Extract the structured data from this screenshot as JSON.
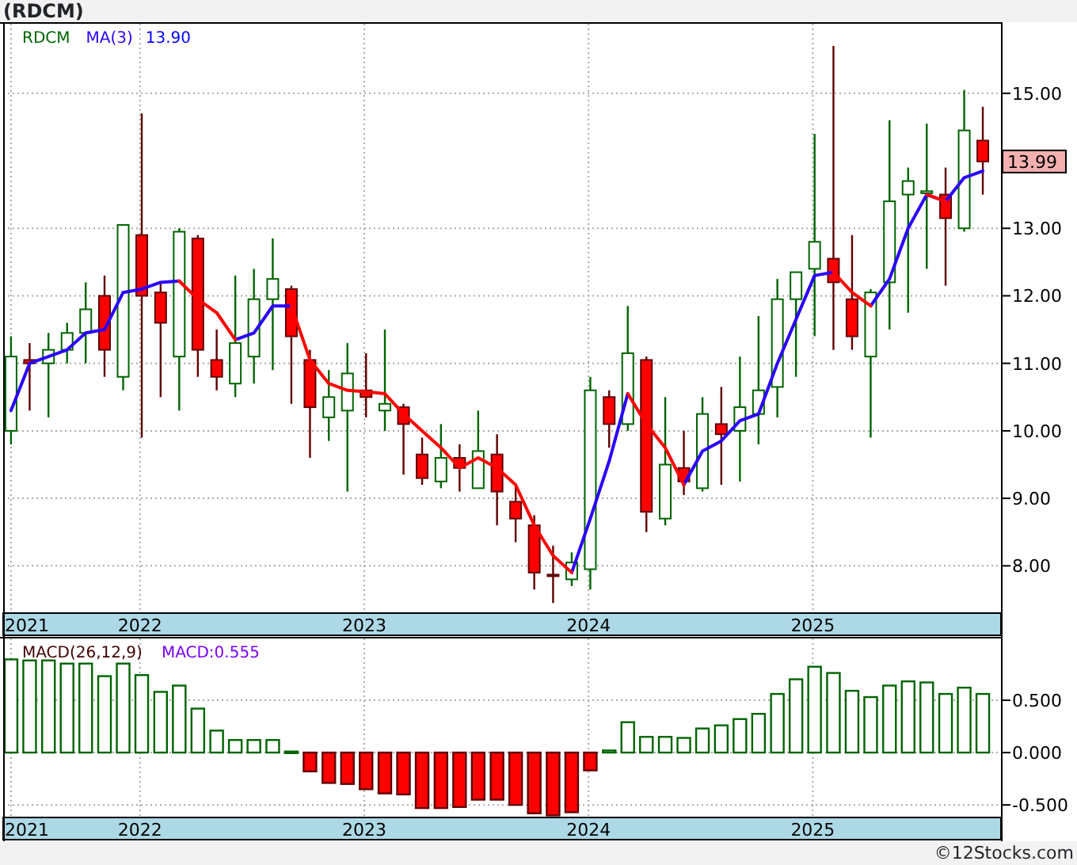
{
  "title": "(RDCM)",
  "price_panel": {
    "symbol": {
      "text": "RDCM",
      "color": "#006400"
    },
    "ma_value": {
      "text": "13.90",
      "color": "#0000ff"
    },
    "last_price": "13.99",
    "axis_start_label": "2021",
    "chart_data": {
      "type": "candlestick",
      "grid": true,
      "x": [
        2021.425,
        2021.508,
        2021.592,
        2021.675,
        2021.758,
        2021.842,
        2021.925,
        2022.008,
        2022.092,
        2022.175,
        2022.258,
        2022.342,
        2022.425,
        2022.508,
        2022.592,
        2022.675,
        2022.758,
        2022.842,
        2022.925,
        2023.008,
        2023.092,
        2023.175,
        2023.258,
        2023.342,
        2023.425,
        2023.508,
        2023.592,
        2023.675,
        2023.758,
        2023.842,
        2023.925,
        2024.008,
        2024.092,
        2024.175,
        2024.258,
        2024.342,
        2024.425,
        2024.508,
        2024.592,
        2024.675,
        2024.758,
        2024.842,
        2024.925,
        2025.008,
        2025.092,
        2025.175,
        2025.258,
        2025.342,
        2025.425,
        2025.508,
        2025.592,
        2025.675,
        2025.758
      ],
      "xlim": [
        2021.39,
        2025.839
      ],
      "ylim": [
        7.3,
        16.03
      ],
      "xticks": [
        {
          "value": 2022,
          "label": "2022"
        },
        {
          "value": 2023,
          "label": "2023"
        },
        {
          "value": 2024,
          "label": "2024"
        },
        {
          "value": 2025,
          "label": "2025"
        }
      ],
      "yticks": [
        {
          "value": 8,
          "label": "8.00"
        },
        {
          "value": 9,
          "label": "9.00"
        },
        {
          "value": 10,
          "label": "10.00"
        },
        {
          "value": 11,
          "label": "11.00"
        },
        {
          "value": 12,
          "label": "12.00"
        },
        {
          "value": 13,
          "label": "13.00"
        },
        {
          "value": 15,
          "label": "15.00"
        }
      ],
      "ohlc": [
        [
          10.0,
          11.4,
          9.8,
          11.1
        ],
        [
          11.05,
          11.3,
          10.3,
          11.0
        ],
        [
          11.0,
          11.45,
          10.2,
          11.2
        ],
        [
          11.2,
          11.6,
          11.0,
          11.45
        ],
        [
          11.45,
          12.2,
          11.0,
          11.8
        ],
        [
          12.0,
          12.3,
          10.8,
          11.2
        ],
        [
          10.8,
          13.05,
          10.6,
          13.05
        ],
        [
          12.9,
          14.7,
          9.9,
          12.0
        ],
        [
          12.05,
          12.2,
          10.5,
          11.6
        ],
        [
          11.1,
          13.0,
          10.3,
          12.95
        ],
        [
          12.85,
          12.9,
          10.8,
          11.2
        ],
        [
          11.05,
          11.5,
          10.6,
          10.8
        ],
        [
          10.7,
          12.3,
          10.5,
          11.3
        ],
        [
          11.1,
          12.4,
          10.7,
          11.95
        ],
        [
          11.95,
          12.85,
          10.9,
          12.25
        ],
        [
          12.1,
          12.15,
          10.4,
          11.4
        ],
        [
          11.05,
          11.2,
          9.6,
          10.35
        ],
        [
          10.2,
          10.9,
          9.85,
          10.5
        ],
        [
          10.3,
          11.3,
          9.1,
          10.85
        ],
        [
          10.6,
          11.15,
          10.2,
          10.5
        ],
        [
          10.3,
          11.5,
          10.0,
          10.4
        ],
        [
          10.35,
          10.4,
          9.35,
          10.1
        ],
        [
          9.65,
          9.9,
          9.2,
          9.3
        ],
        [
          9.25,
          10.1,
          9.15,
          9.6
        ],
        [
          9.6,
          9.8,
          9.1,
          9.45
        ],
        [
          9.15,
          10.3,
          9.15,
          9.7
        ],
        [
          9.65,
          9.95,
          8.6,
          9.1
        ],
        [
          8.95,
          9.2,
          8.35,
          8.7
        ],
        [
          8.6,
          8.75,
          7.65,
          7.9
        ],
        [
          7.87,
          8.3,
          7.45,
          7.85
        ],
        [
          7.8,
          8.2,
          7.7,
          8.05
        ],
        [
          7.95,
          10.8,
          7.65,
          10.6
        ],
        [
          10.5,
          10.6,
          9.75,
          10.1
        ],
        [
          10.1,
          11.85,
          10.0,
          11.15
        ],
        [
          11.05,
          11.1,
          8.5,
          8.8
        ],
        [
          8.7,
          10.5,
          8.6,
          9.5
        ],
        [
          9.45,
          10.0,
          9.05,
          9.25
        ],
        [
          9.15,
          10.5,
          9.1,
          10.25
        ],
        [
          10.1,
          10.65,
          9.2,
          9.95
        ],
        [
          10.0,
          11.1,
          9.25,
          10.35
        ],
        [
          10.25,
          11.7,
          9.8,
          10.6
        ],
        [
          10.65,
          12.25,
          10.2,
          11.95
        ],
        [
          11.95,
          12.35,
          10.8,
          12.35
        ],
        [
          12.4,
          14.4,
          11.4,
          12.8
        ],
        [
          12.55,
          15.7,
          11.2,
          12.2
        ],
        [
          11.95,
          12.9,
          11.2,
          11.4
        ],
        [
          11.1,
          12.1,
          9.9,
          12.05
        ],
        [
          12.2,
          14.6,
          11.5,
          13.4
        ],
        [
          13.5,
          13.9,
          11.75,
          13.7
        ],
        [
          13.52,
          14.55,
          12.4,
          13.55
        ],
        [
          13.5,
          13.9,
          12.15,
          13.15
        ],
        [
          13.0,
          15.05,
          12.95,
          14.45
        ],
        [
          14.3,
          14.8,
          13.5,
          13.99
        ]
      ],
      "series": [
        {
          "name": "MA(3)",
          "type": "line",
          "color": "#2a00ff",
          "values": [
            10.3,
            11.0,
            11.1,
            11.2,
            11.45,
            11.5,
            12.05,
            12.1,
            12.2,
            12.22,
            null,
            null,
            11.35,
            11.45,
            11.85,
            11.85,
            null,
            null,
            null,
            null,
            null,
            null,
            null,
            null,
            null,
            null,
            null,
            null,
            null,
            null,
            7.9,
            8.7,
            9.55,
            10.55,
            null,
            null,
            9.2,
            9.7,
            9.85,
            10.15,
            10.25,
            11.0,
            11.65,
            12.3,
            12.35,
            null,
            11.85,
            12.25,
            13.0,
            13.5,
            13.4,
            13.75,
            13.85
          ]
        },
        {
          "type": "line",
          "color": "#ff0000",
          "values": [
            null,
            null,
            null,
            null,
            null,
            null,
            null,
            null,
            null,
            12.22,
            11.95,
            11.75,
            11.35,
            null,
            null,
            11.85,
            11.05,
            10.7,
            10.6,
            10.58,
            10.55,
            10.25,
            10.0,
            9.75,
            9.45,
            9.6,
            9.45,
            9.2,
            8.6,
            8.15,
            7.9,
            null,
            null,
            10.55,
            10.1,
            9.75,
            9.2,
            null,
            null,
            null,
            null,
            null,
            null,
            null,
            12.35,
            12.05,
            11.85,
            null,
            null,
            13.5,
            13.4,
            null,
            null
          ]
        }
      ]
    }
  },
  "macd_panel": {
    "value_label": {
      "text": "MACD:0.555",
      "color": "#7a00ff"
    },
    "axis_start_label": "2021",
    "chart_data": {
      "type": "bar",
      "grid": true,
      "x": [
        2021.425,
        2021.508,
        2021.592,
        2021.675,
        2021.758,
        2021.842,
        2021.925,
        2022.008,
        2022.092,
        2022.175,
        2022.258,
        2022.342,
        2022.425,
        2022.508,
        2022.592,
        2022.675,
        2022.758,
        2022.842,
        2022.925,
        2023.008,
        2023.092,
        2023.175,
        2023.258,
        2023.342,
        2023.425,
        2023.508,
        2023.592,
        2023.675,
        2023.758,
        2023.842,
        2023.925,
        2024.008,
        2024.092,
        2024.175,
        2024.258,
        2024.342,
        2024.425,
        2024.508,
        2024.592,
        2024.675,
        2024.758,
        2024.842,
        2024.925,
        2025.008,
        2025.092,
        2025.175,
        2025.258,
        2025.342,
        2025.425,
        2025.508,
        2025.592,
        2025.675,
        2025.758
      ],
      "xlim": [
        2021.39,
        2025.839
      ],
      "ylim": [
        -0.62,
        1.09
      ],
      "xticks": [
        {
          "value": 2022,
          "label": "2022"
        },
        {
          "value": 2023,
          "label": "2023"
        },
        {
          "value": 2024,
          "label": "2024"
        },
        {
          "value": 2025,
          "label": "2025"
        }
      ],
      "yticks": [
        {
          "value": -0.5,
          "label": "-0.500"
        },
        {
          "value": 0,
          "label": "0.000"
        },
        {
          "value": 0.5,
          "label": "0.500"
        }
      ],
      "series": [
        {
          "name": "MACD(26,12,9)",
          "color": "#006400",
          "values": [
            0.89,
            0.88,
            0.88,
            0.85,
            0.85,
            0.73,
            0.85,
            0.74,
            0.58,
            0.64,
            0.42,
            0.21,
            0.12,
            0.12,
            0.12,
            0.01,
            null,
            null,
            null,
            null,
            null,
            null,
            null,
            null,
            null,
            null,
            null,
            null,
            null,
            null,
            null,
            null,
            0.02,
            0.29,
            0.15,
            0.15,
            0.14,
            0.23,
            0.26,
            0.32,
            0.37,
            0.56,
            0.7,
            0.82,
            0.76,
            0.59,
            0.53,
            0.64,
            0.68,
            0.67,
            0.56,
            0.62,
            0.56
          ]
        },
        {
          "color": "#ff0000",
          "values": [
            null,
            null,
            null,
            null,
            null,
            null,
            null,
            null,
            null,
            null,
            null,
            null,
            null,
            null,
            null,
            null,
            -0.18,
            -0.29,
            -0.3,
            -0.35,
            -0.39,
            -0.4,
            -0.53,
            -0.53,
            -0.52,
            -0.45,
            -0.45,
            -0.5,
            -0.58,
            -0.6,
            -0.57,
            -0.17,
            null,
            null,
            null,
            null,
            null,
            null,
            null,
            null,
            null,
            null,
            null,
            null,
            null,
            null,
            null,
            null,
            null,
            null,
            null,
            null,
            null
          ]
        }
      ]
    }
  },
  "copyright": "©12Stocks.com"
}
